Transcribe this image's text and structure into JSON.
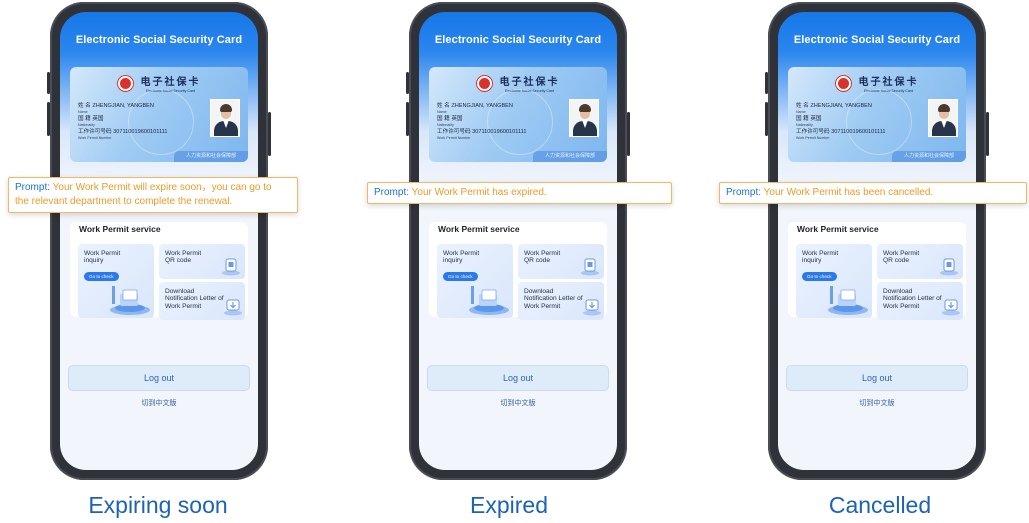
{
  "app": {
    "title": "Electronic Social Security Card"
  },
  "card": {
    "title_cn": "电子社保卡",
    "title_en": "Electronic Social Security Card",
    "name_label_cn": "姓 名",
    "name_value": "ZHENGJIAN, YANGBEN",
    "name_label_en": "Name",
    "nationality_label_cn": "国 籍",
    "nationality_value": "英国",
    "nationality_label_en": "Nationality",
    "permit_label_cn": "工作许可号码",
    "permit_value": "307110019600101111",
    "permit_label_en": "Work Permit Number",
    "issuer": "人力资源和社会保障部"
  },
  "service": {
    "title": "Work Permit service",
    "tiles": [
      {
        "label": "Work Permit inquiry",
        "button": "Go to check"
      },
      {
        "label": "Work Permit QR code"
      },
      {
        "label": "Download Notification Letter of Work Permit"
      }
    ]
  },
  "logout_label": "Log out",
  "language_switch": "切到中文版",
  "prompt_key": "Prompt:",
  "screens": [
    {
      "caption": "Expiring soon",
      "prompt_lines": [
        "Your Work Permit will expire soon，you can go to",
        "the relevant department to complete the renewal."
      ]
    },
    {
      "caption": "Expired",
      "prompt_lines": [
        "Your Work Permit has expired."
      ]
    },
    {
      "caption": "Cancelled",
      "prompt_lines": [
        "Your Work Permit has been cancelled."
      ]
    }
  ],
  "colors": {
    "header_blue": "#1677e8",
    "prompt_text": "#f09a27",
    "prompt_border": "#f4b764",
    "caption": "#1b63b5"
  }
}
